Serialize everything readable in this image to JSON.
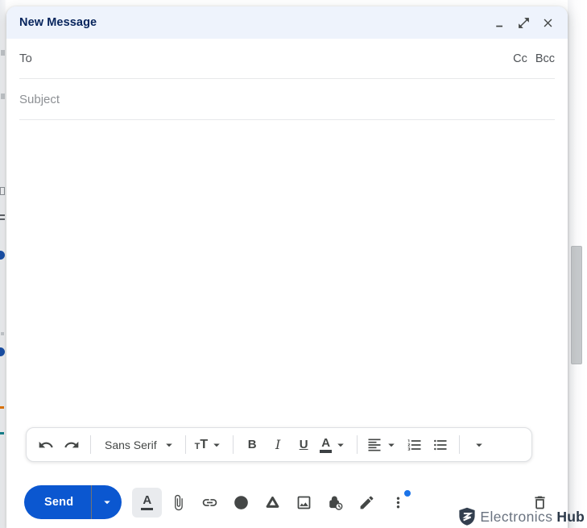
{
  "window": {
    "title": "New Message",
    "controls": {
      "minimize": "minimize",
      "popout": "open in full",
      "close": "close"
    }
  },
  "recipients": {
    "to_label": "To",
    "cc_label": "Cc",
    "bcc_label": "Bcc"
  },
  "subject": {
    "placeholder": "Subject"
  },
  "body": {
    "text": ""
  },
  "format_toolbar": {
    "font_label": "Sans Serif",
    "size_small": "T",
    "size_large": "T",
    "bold_label": "B",
    "italic_label": "I",
    "underline_label": "U",
    "color_label": "A"
  },
  "bottom_bar": {
    "send_label": "Send"
  },
  "watermark": {
    "brand_light": "Electronics",
    "brand_bold": "Hub"
  },
  "icons": {
    "titlebar": [
      "minimize-icon",
      "popout-icon",
      "close-icon"
    ],
    "format_toolbar": [
      "undo-icon",
      "redo-icon",
      "font-dropdown-icon",
      "text-size-icon",
      "bold-icon",
      "italic-icon",
      "underline-icon",
      "text-color-icon",
      "align-left-icon",
      "numbered-list-icon",
      "bullet-list-icon",
      "more-format-icon"
    ],
    "bottom_bar": [
      "send-dropdown-icon",
      "formatting-icon",
      "attach-icon",
      "link-icon",
      "emoji-icon",
      "drive-icon",
      "image-icon",
      "confidential-lock-icon",
      "signature-pen-icon",
      "more-options-icon",
      "trash-icon"
    ],
    "watermark": "shield-logo-icon"
  },
  "colors": {
    "send_blue": "#0b57d0",
    "header_bg": "#eef3fc",
    "title_text": "#07245c",
    "icon_gray": "#444746",
    "notification_dot": "#1a73e8",
    "divider": "#e7e8ea",
    "active_button_bg": "#e9ebee",
    "scrollbar_thumb": "#c7cacd"
  }
}
